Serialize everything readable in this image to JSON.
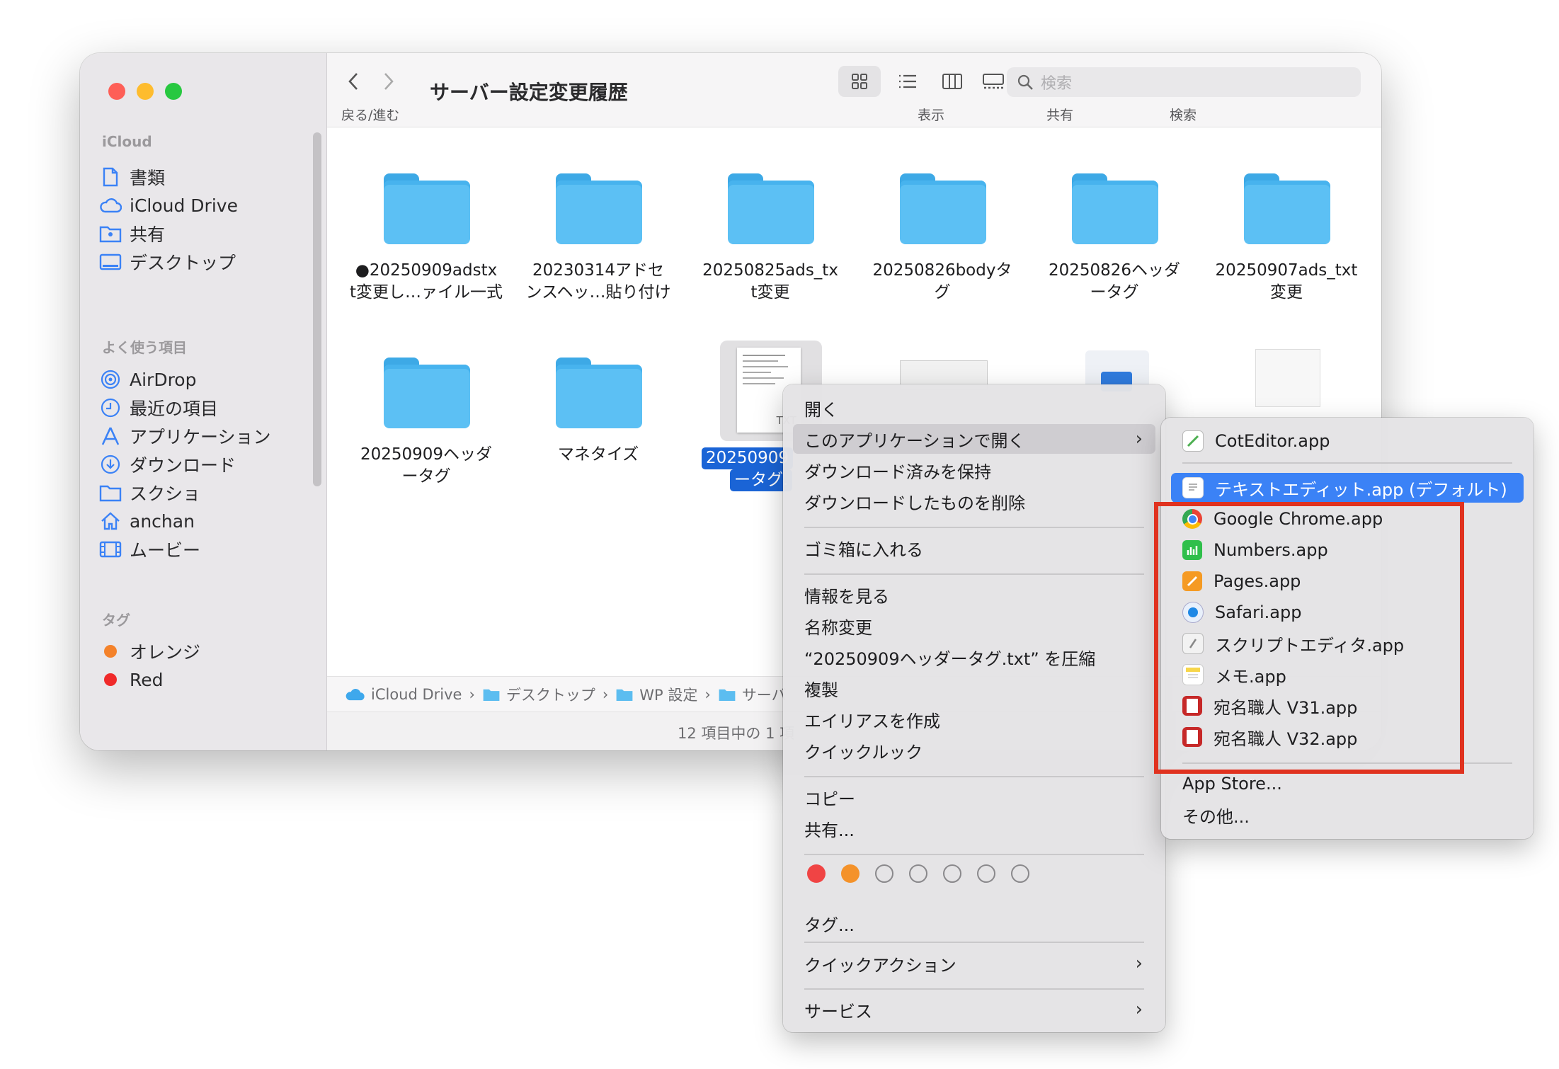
{
  "sidebar": {
    "sections": [
      "iCloud",
      "よく使う項目",
      "タグ"
    ],
    "icloud_items": [
      {
        "label": "書類",
        "icon": "document-icon"
      },
      {
        "label": "iCloud Drive",
        "icon": "cloud-icon"
      },
      {
        "label": "共有",
        "icon": "shared-folder-icon"
      },
      {
        "label": "デスクトップ",
        "icon": "desktop-icon"
      }
    ],
    "favorite_items": [
      {
        "label": "AirDrop",
        "icon": "airdrop-icon"
      },
      {
        "label": "最近の項目",
        "icon": "clock-icon"
      },
      {
        "label": "アプリケーション",
        "icon": "applications-icon"
      },
      {
        "label": "ダウンロード",
        "icon": "download-icon"
      },
      {
        "label": "スクショ",
        "icon": "folder-icon"
      },
      {
        "label": "anchan",
        "icon": "home-icon"
      },
      {
        "label": "ムービー",
        "icon": "film-icon"
      }
    ],
    "tag_items": [
      {
        "label": "オレンジ",
        "color": "#f4822a"
      },
      {
        "label": "Red",
        "color": "#f02a2a"
      }
    ]
  },
  "toolbar": {
    "title": "サーバー設定変更履歴",
    "nav_label": "戻る/進む",
    "view_label": "表示",
    "share_label": "共有",
    "search_label": "検索",
    "search_placeholder": "検索"
  },
  "files": [
    {
      "name": "●20250909adstx\nt変更し…ァイル一式",
      "kind": "folder"
    },
    {
      "name": "20230314アドセ\nンスヘッ…貼り付け",
      "kind": "folder"
    },
    {
      "name": "20250825ads_tx\nt変更",
      "kind": "folder"
    },
    {
      "name": "20250826bodyタ\nグ",
      "kind": "folder"
    },
    {
      "name": "20250826ヘッダ\nータグ",
      "kind": "folder"
    },
    {
      "name": "20250907ads_txt\n変更",
      "kind": "folder"
    },
    {
      "name": "20250909ヘッダ\nータグ",
      "kind": "folder"
    },
    {
      "name": "マネタイズ",
      "kind": "folder"
    },
    {
      "name_line1": "20250909",
      "name_line2": "ータグ.",
      "kind": "txt",
      "badge": "TXT"
    }
  ],
  "pathbar": [
    "iCloud Drive",
    "デスクトップ",
    "WP 設定",
    "サーバ"
  ],
  "status": "12 項目中の 1 項",
  "context_menu": {
    "items": [
      "開く",
      "このアプリケーションで開く",
      "ダウンロード済みを保持",
      "ダウンロードしたものを削除",
      "ゴミ箱に入れる",
      "情報を見る",
      "名称変更",
      "“20250909ヘッダータグ.txt” を圧縮",
      "複製",
      "エイリアスを作成",
      "クイックルック",
      "コピー",
      "共有...",
      "タグ...",
      "クイックアクション",
      "サービス"
    ],
    "tag_colors": [
      "#f04444",
      "#f4922a"
    ]
  },
  "submenu": {
    "apps": [
      {
        "label": "CotEditor.app",
        "icon": "coteditor-icon"
      },
      {
        "label": "テキストエディット.app (デフォルト)",
        "icon": "textedit-icon"
      },
      {
        "label": "Google Chrome.app",
        "icon": "chrome-icon"
      },
      {
        "label": "Numbers.app",
        "icon": "numbers-icon"
      },
      {
        "label": "Pages.app",
        "icon": "pages-icon"
      },
      {
        "label": "Safari.app",
        "icon": "safari-icon"
      },
      {
        "label": "スクリプトエディタ.app",
        "icon": "script-editor-icon"
      },
      {
        "label": "メモ.app",
        "icon": "notes-icon"
      },
      {
        "label": "宛名職人 V31.app",
        "icon": "atena-icon"
      },
      {
        "label": "宛名職人 V32.app",
        "icon": "atena-icon"
      }
    ],
    "extra": [
      "App Store...",
      "その他..."
    ],
    "highlight_color": "#e0321f",
    "selection_color": "#3b82f6"
  }
}
